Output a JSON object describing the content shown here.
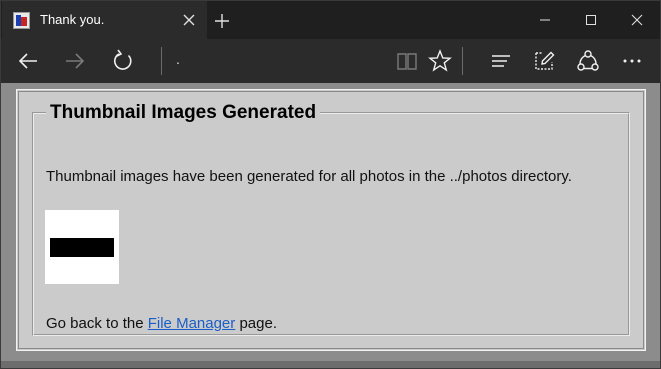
{
  "window": {
    "tab_title": "Thank you.",
    "address": "."
  },
  "page": {
    "heading": "Thumbnail Images Generated",
    "message": "Thumbnail images have been generated for all photos in the ../photos directory.",
    "back_prefix": "Go back to the ",
    "back_link": "File Manager",
    "back_suffix": " page."
  },
  "icons": [
    "edge-favicon-icon",
    "close-tab-icon",
    "new-tab-icon",
    "minimize-icon",
    "maximize-icon",
    "close-window-icon",
    "back-icon",
    "forward-icon",
    "refresh-icon",
    "reading-view-icon",
    "favorite-star-icon",
    "hub-icon",
    "web-note-icon",
    "share-icon",
    "more-icon"
  ]
}
